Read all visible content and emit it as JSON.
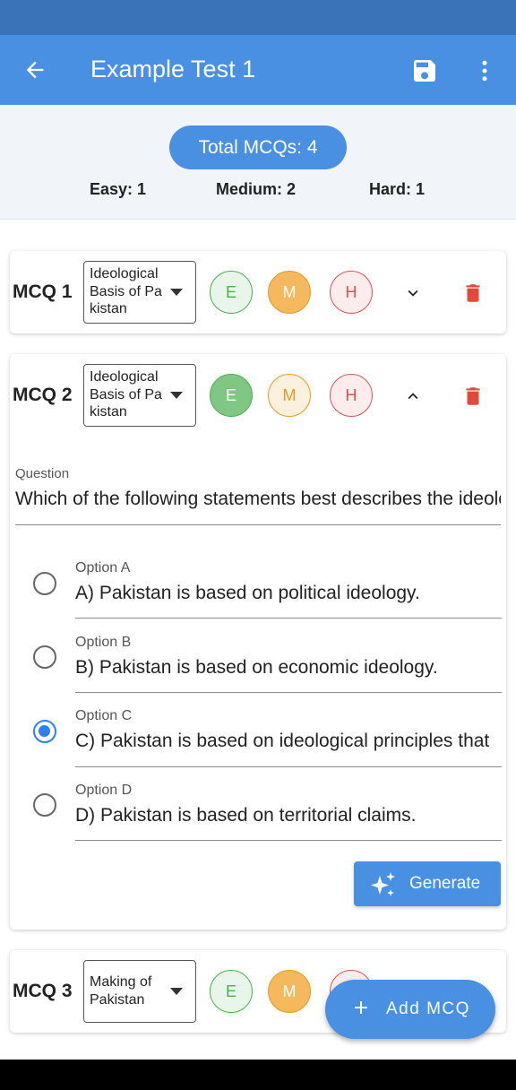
{
  "app_bar": {
    "title": "Example Test 1",
    "back_icon": "arrow-left-icon",
    "save_icon": "save-icon",
    "more_icon": "more-vertical-icon"
  },
  "summary": {
    "total": "Total MCQs: 4",
    "easy": "Easy: 1",
    "medium": "Medium: 2",
    "hard": "Hard: 1"
  },
  "colors": {
    "primary": "#4a90e2",
    "easy": "#4caf50",
    "medium": "#e49a2a",
    "hard": "#d9534f",
    "delete": "#e04a3a"
  },
  "mcqs": [
    {
      "label": "MCQ 1",
      "topic": "Ideological Basis of Pakistan",
      "difficulty": "M",
      "expanded": false
    },
    {
      "label": "MCQ 2",
      "topic": "Ideological Basis of Pakistan",
      "difficulty": "E",
      "expanded": true,
      "question_caption": "Question",
      "question": "Which of the following statements best describes the ideological basis of Pakistan?",
      "options": [
        {
          "caption": "Option A",
          "text": "A) Pakistan is based on political ideology.",
          "selected": false
        },
        {
          "caption": "Option B",
          "text": "B) Pakistan is based on economic ideology.",
          "selected": false
        },
        {
          "caption": "Option C",
          "text": "C) Pakistan is based on ideological principles that",
          "selected": true
        },
        {
          "caption": "Option D",
          "text": "D) Pakistan is based on territorial claims.",
          "selected": false
        }
      ],
      "generate_label": "Generate"
    },
    {
      "label": "MCQ 3",
      "topic": "Making of Pakistan",
      "difficulty": "M",
      "expanded": false
    }
  ],
  "difficulty_labels": {
    "easy": "E",
    "medium": "M",
    "hard": "H"
  },
  "fab": {
    "label": "Add MCQ"
  }
}
